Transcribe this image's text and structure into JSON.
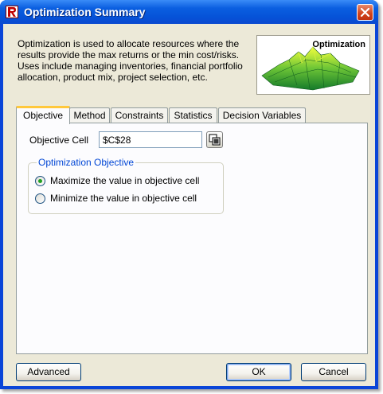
{
  "window": {
    "title": "Optimization Summary"
  },
  "description": "Optimization is used to allocate resources where the results provide the max returns or the min cost/risks. Uses include managing inventories, financial portfolio allocation, product mix, project selection, etc.",
  "logo": {
    "label": "Optimization"
  },
  "tabs": [
    {
      "label": "Objective",
      "active": true
    },
    {
      "label": "Method",
      "active": false
    },
    {
      "label": "Constraints",
      "active": false
    },
    {
      "label": "Statistics",
      "active": false
    },
    {
      "label": "Decision Variables",
      "active": false
    }
  ],
  "objective": {
    "cell_label": "Objective Cell",
    "cell_value": "$C$28",
    "group_title": "Optimization Objective",
    "options": [
      {
        "label": "Maximize the value in objective cell",
        "checked": true
      },
      {
        "label": "Minimize the value in objective cell",
        "checked": false
      }
    ]
  },
  "buttons": {
    "advanced": "Advanced",
    "ok": "OK",
    "cancel": "Cancel"
  },
  "colors": {
    "titlebar": "#0a5ee0",
    "accent_tab": "#ffc83c",
    "group_title": "#0046d5",
    "radio_dot": "#21a121"
  }
}
